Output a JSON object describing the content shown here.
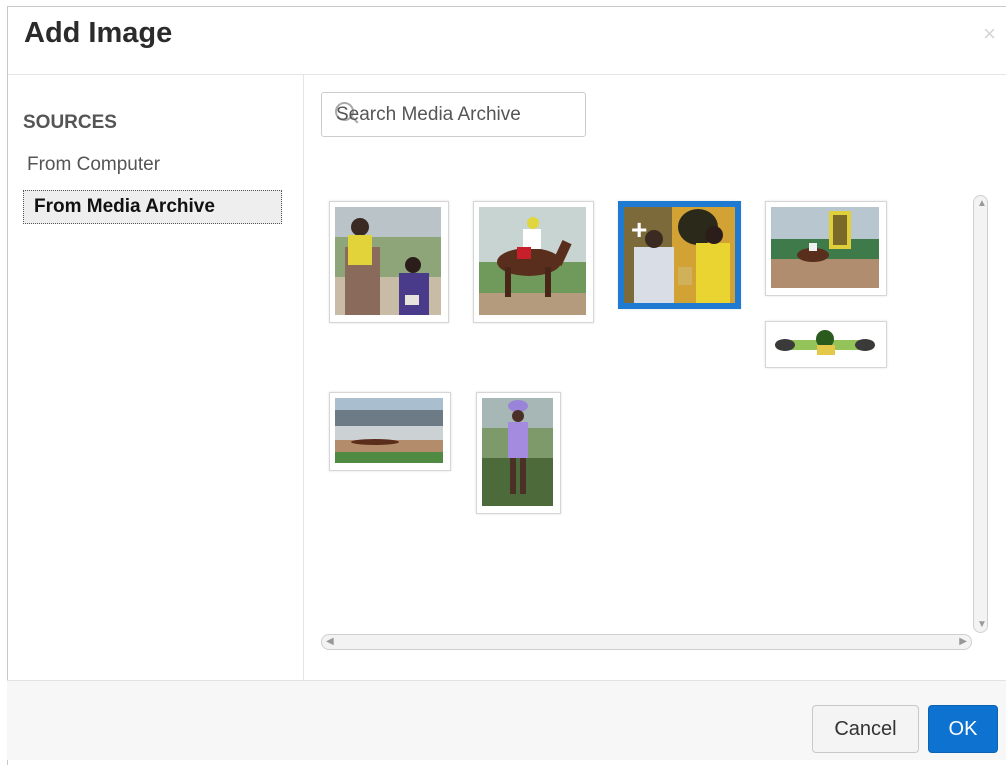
{
  "dialog": {
    "title": "Add Image",
    "close_glyph": "×"
  },
  "sidebar": {
    "heading": "SOURCES",
    "items": [
      {
        "label": "From Computer",
        "selected": false
      },
      {
        "label": "From Media Archive",
        "selected": true
      }
    ]
  },
  "search": {
    "placeholder": "Search Media Archive",
    "icon": "search-icon"
  },
  "thumbnails": [
    {
      "name": "jockey-on-horse-with-groom",
      "selected": false
    },
    {
      "name": "horse-racing-jockey",
      "selected": false
    },
    {
      "name": "trophy-presentation",
      "selected": true
    },
    {
      "name": "race-finish-line",
      "selected": false
    },
    {
      "name": "racing-banner-logo",
      "selected": false
    },
    {
      "name": "grandstand-racetrack",
      "selected": false
    },
    {
      "name": "woman-in-purple-dress",
      "selected": false
    }
  ],
  "footer": {
    "cancel_label": "Cancel",
    "ok_label": "OK"
  },
  "colors": {
    "primary": "#0d72d0",
    "selected_thumb": "#1f7bd1"
  }
}
